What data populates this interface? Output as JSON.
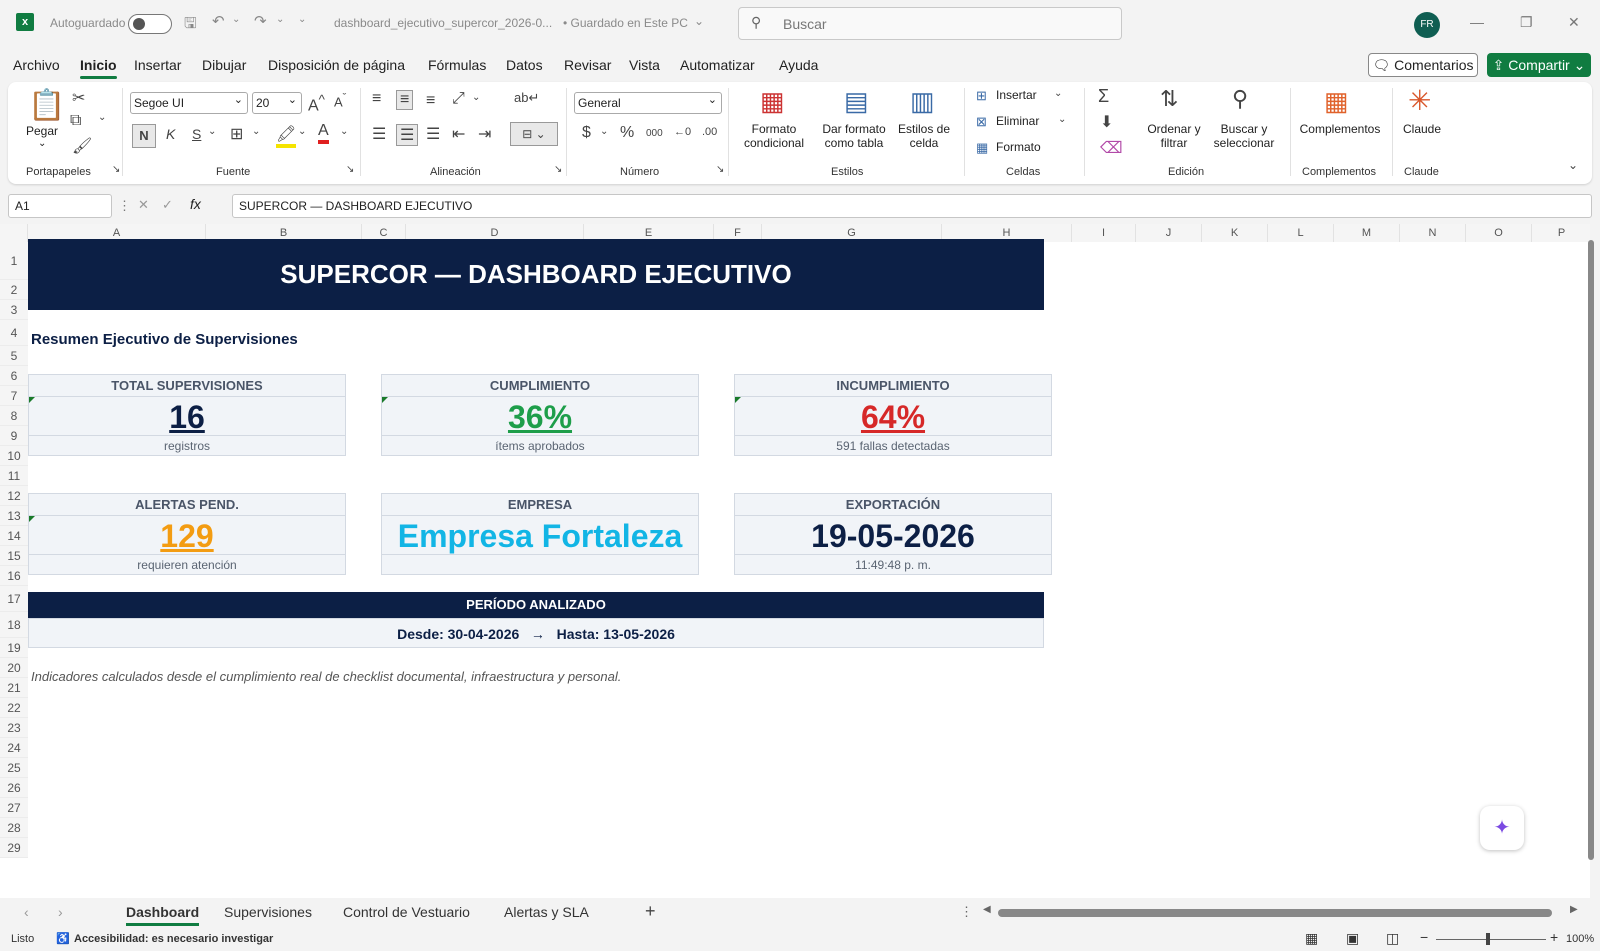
{
  "titlebar": {
    "autosave_label": "Autoguardado",
    "filename": "dashboard_ejecutivo_supercor_2026-0...",
    "save_status": "• Guardado en Este PC",
    "search_placeholder": "Buscar",
    "avatar_initials": "FR"
  },
  "menu": {
    "tabs": [
      "Archivo",
      "Inicio",
      "Insertar",
      "Dibujar",
      "Disposición de página",
      "Fórmulas",
      "Datos",
      "Revisar",
      "Vista",
      "Automatizar",
      "Ayuda"
    ],
    "active": "Inicio",
    "comments_label": "Comentarios",
    "share_label": "Compartir"
  },
  "ribbon": {
    "paste_label": "Pegar",
    "font_name": "Segoe UI",
    "font_size": "20",
    "number_format": "General",
    "bold_label": "N",
    "italic_label": "K",
    "underline_label": "S",
    "cond_format": "Formato condicional",
    "format_table": "Dar formato como tabla",
    "cell_styles": "Estilos de celda",
    "insert": "Insertar",
    "delete": "Eliminar",
    "format": "Formato",
    "sort_filter": "Ordenar y filtrar",
    "find_select": "Buscar y seleccionar",
    "addins": "Complementos",
    "claude": "Claude",
    "groups": [
      "Portapapeles",
      "Fuente",
      "Alineación",
      "Número",
      "Estilos",
      "Celdas",
      "Edición",
      "Complementos",
      "Claude"
    ]
  },
  "formula_bar": {
    "cell_ref": "A1",
    "fx": "fx",
    "content": "SUPERCOR — DASHBOARD EJECUTIVO"
  },
  "columns": [
    "A",
    "B",
    "C",
    "D",
    "E",
    "F",
    "G",
    "H",
    "I",
    "J",
    "K",
    "L",
    "M",
    "N",
    "O",
    "P"
  ],
  "rows": [
    "1",
    "2",
    "3",
    "4",
    "5",
    "6",
    "7",
    "8",
    "9",
    "10",
    "11",
    "12",
    "13",
    "14",
    "15",
    "16",
    "17",
    "18",
    "19",
    "20",
    "21",
    "22",
    "23",
    "24",
    "25",
    "26",
    "27",
    "28",
    "29"
  ],
  "dashboard": {
    "title": "SUPERCOR — DASHBOARD EJECUTIVO",
    "subtitle": "Resumen Ejecutivo de Supervisiones",
    "cards": [
      {
        "title": "TOTAL SUPERVISIONES",
        "value": "16",
        "sub": "registros",
        "color": "#0c1f45"
      },
      {
        "title": "CUMPLIMIENTO",
        "value": "36%",
        "sub": "ítems aprobados",
        "color": "#1e9e4a"
      },
      {
        "title": "INCUMPLIMIENTO",
        "value": "64%",
        "sub": "591 fallas detectadas",
        "color": "#d62828"
      },
      {
        "title": "ALERTAS PEND.",
        "value": "129",
        "sub": "requieren atención",
        "color": "#f39c12"
      },
      {
        "title": "EMPRESA",
        "value": "Empresa Fortaleza",
        "sub": "",
        "color": "#12b5e5"
      },
      {
        "title": "EXPORTACIÓN",
        "value": "19-05-2026",
        "sub": "11:49:48 p. m.",
        "color": "#0c1f45"
      }
    ],
    "period_title": "PERÍODO ANALIZADO",
    "period_range": "Desde: 30-04-2026   →   Hasta: 13-05-2026",
    "note": "Indicadores calculados desde el cumplimiento real de checklist documental, infraestructura y personal."
  },
  "sheet_tabs": [
    "Dashboard",
    "Supervisiones",
    "Control de Vestuario",
    "Alertas y SLA"
  ],
  "status": {
    "ready": "Listo",
    "accessibility": "Accesibilidad: es necesario investigar",
    "zoom": "100%"
  }
}
